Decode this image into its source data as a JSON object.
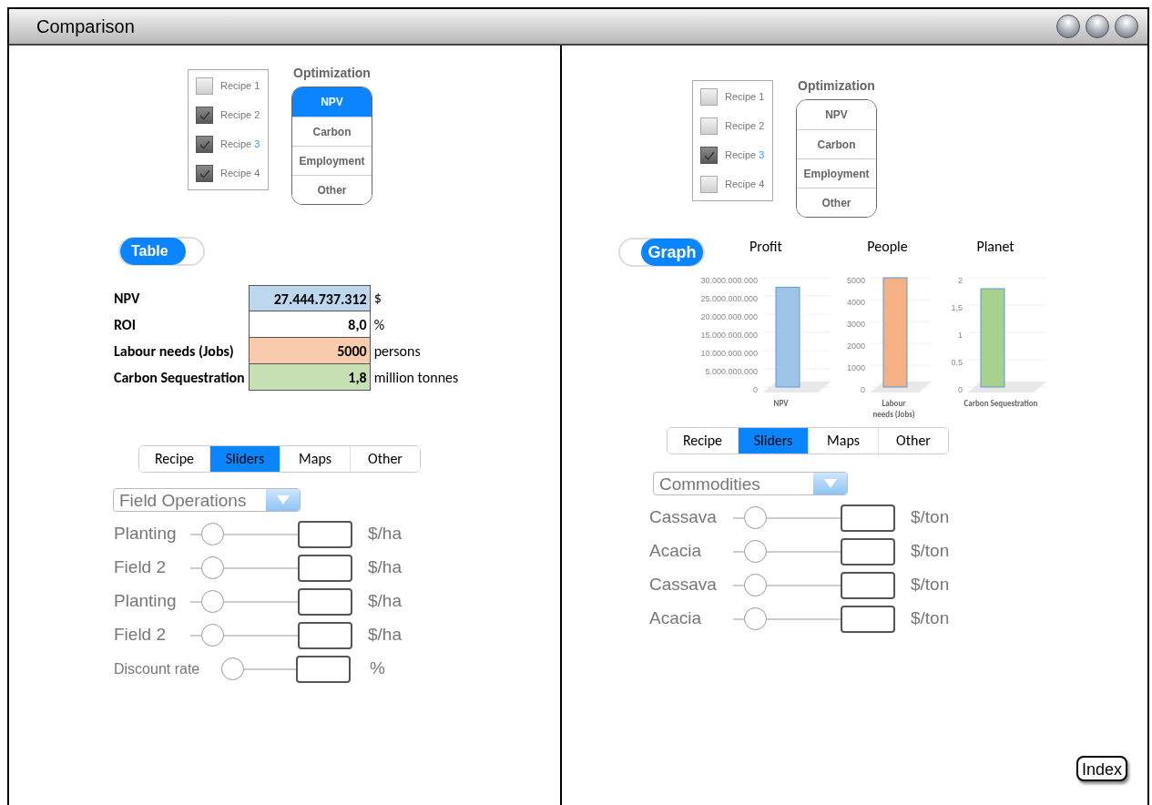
{
  "window": {
    "title": "Comparison"
  },
  "panels": [
    {
      "recipes": [
        {
          "label": "Recipe",
          "number": "1",
          "checked": false,
          "number_highlight": false
        },
        {
          "label": "Recipe",
          "number": "2",
          "checked": true,
          "number_highlight": false
        },
        {
          "label": "Recipe",
          "number": "3",
          "checked": true,
          "number_highlight": true
        },
        {
          "label": "Recipe",
          "number": "4",
          "checked": true,
          "number_highlight": false
        }
      ],
      "optimization": {
        "title": "Optimization",
        "options": [
          {
            "label": "NPV",
            "selected": true
          },
          {
            "label": "Carbon",
            "selected": false
          },
          {
            "label": "Employment",
            "selected": false
          },
          {
            "label": "Other",
            "selected": false
          }
        ]
      },
      "view_toggle": {
        "label": "Table",
        "switched_right": false
      },
      "results": {
        "kind": "table",
        "rows": [
          {
            "label": "NPV",
            "value": "27.444.737.312",
            "unit": "$",
            "color": "#bdd7ee"
          },
          {
            "label": "ROI",
            "value": "8,0",
            "unit": "%",
            "color": "#ffffff"
          },
          {
            "label": "Labour needs (Jobs)",
            "value": "5000",
            "unit": "persons",
            "color": "#f8cbad"
          },
          {
            "label": "Carbon Sequestration",
            "value": "1,8",
            "unit": "million tonnes",
            "color": "#c6e0b4"
          }
        ]
      },
      "tabs": [
        {
          "label": "Recipe",
          "selected": false
        },
        {
          "label": "Sliders",
          "selected": true
        },
        {
          "label": "Maps",
          "selected": false
        },
        {
          "label": "Other",
          "selected": false
        }
      ],
      "dropdown": {
        "value": "Field Operations"
      },
      "sliders": [
        {
          "kind": "wide",
          "label": "Planting",
          "level": 0.2,
          "unit": "$/ha"
        },
        {
          "kind": "wide",
          "label": "Field 2",
          "level": 0.2,
          "unit": "$/ha"
        },
        {
          "kind": "wide",
          "label": "Planting",
          "level": 0.2,
          "unit": "$/ha"
        },
        {
          "kind": "wide",
          "label": "Field 2",
          "level": 0.2,
          "unit": "$/ha"
        },
        {
          "kind": "compact",
          "label": "Discount rate",
          "level": 0.15,
          "unit": "%"
        }
      ]
    },
    {
      "recipes": [
        {
          "label": "Recipe",
          "number": "1",
          "checked": false,
          "number_highlight": false
        },
        {
          "label": "Recipe",
          "number": "2",
          "checked": false,
          "number_highlight": false
        },
        {
          "label": "Recipe",
          "number": "3",
          "checked": true,
          "number_highlight": true
        },
        {
          "label": "Recipe",
          "number": "4",
          "checked": false,
          "number_highlight": false
        }
      ],
      "optimization": {
        "title": "Optimization",
        "options": [
          {
            "label": "NPV",
            "selected": false
          },
          {
            "label": "Carbon",
            "selected": false
          },
          {
            "label": "Employment",
            "selected": false
          },
          {
            "label": "Other",
            "selected": false
          }
        ]
      },
      "view_toggle": {
        "label": "Graph",
        "switched_right": true
      },
      "results": {
        "kind": "charts",
        "charts": [
          {
            "title": "Profit",
            "chart_data": {
              "type": "bar",
              "categories": [
                "NPV"
              ],
              "series": [
                {
                  "color": "#9dc3e6",
                  "values": [
                    27400000000
                  ]
                }
              ],
              "grid": true,
              "ylim": [
                0,
                30000000000
              ],
              "yticks": [
                {
                  "value": 0,
                  "label": "0"
                },
                {
                  "value": 5000000000,
                  "label": "5.000.000.000"
                },
                {
                  "value": 10000000000,
                  "label": "10.000.000.000"
                },
                {
                  "value": 15000000000,
                  "label": "15.000.000.000"
                },
                {
                  "value": 20000000000,
                  "label": "20.000.000.000"
                },
                {
                  "value": 25000000000,
                  "label": "25.000.000.000"
                },
                {
                  "value": 30000000000,
                  "label": "30.000.000.000"
                }
              ]
            }
          },
          {
            "title": "People",
            "chart_data": {
              "type": "bar",
              "categories": [
                "Labour needs (Jobs)"
              ],
              "series": [
                {
                  "color": "#f4b183",
                  "values": [
                    5000
                  ]
                }
              ],
              "grid": true,
              "ylim": [
                0,
                5000
              ],
              "yticks": [
                {
                  "value": 0,
                  "label": "0"
                },
                {
                  "value": 1000,
                  "label": "1000"
                },
                {
                  "value": 2000,
                  "label": "2000"
                },
                {
                  "value": 3000,
                  "label": "3000"
                },
                {
                  "value": 4000,
                  "label": "4000"
                },
                {
                  "value": 5000,
                  "label": "5000"
                }
              ]
            }
          },
          {
            "title": "Planet",
            "chart_data": {
              "type": "bar",
              "categories": [
                "Carbon Sequestration"
              ],
              "series": [
                {
                  "color": "#a9d18e",
                  "values": [
                    1.8
                  ]
                }
              ],
              "grid": true,
              "ylim": [
                0,
                2
              ],
              "yticks": [
                {
                  "value": 0,
                  "label": "0"
                },
                {
                  "value": 0.5,
                  "label": "0,5"
                },
                {
                  "value": 1,
                  "label": "1"
                },
                {
                  "value": 1.5,
                  "label": "1,5"
                },
                {
                  "value": 2,
                  "label": "2"
                }
              ]
            }
          }
        ]
      },
      "tabs": [
        {
          "label": "Recipe",
          "selected": false
        },
        {
          "label": "Sliders",
          "selected": true
        },
        {
          "label": "Maps",
          "selected": false
        },
        {
          "label": "Other",
          "selected": false
        }
      ],
      "dropdown": {
        "value": "Commodities"
      },
      "sliders": [
        {
          "kind": "wide",
          "label": "Cassava",
          "level": 0.2,
          "unit": "$/ton"
        },
        {
          "kind": "wide",
          "label": "Acacia",
          "level": 0.2,
          "unit": "$/ton"
        },
        {
          "kind": "wide",
          "label": "Cassava",
          "level": 0.2,
          "unit": "$/ton"
        },
        {
          "kind": "wide",
          "label": "Acacia",
          "level": 0.2,
          "unit": "$/ton"
        }
      ]
    }
  ],
  "index_button": "Index"
}
